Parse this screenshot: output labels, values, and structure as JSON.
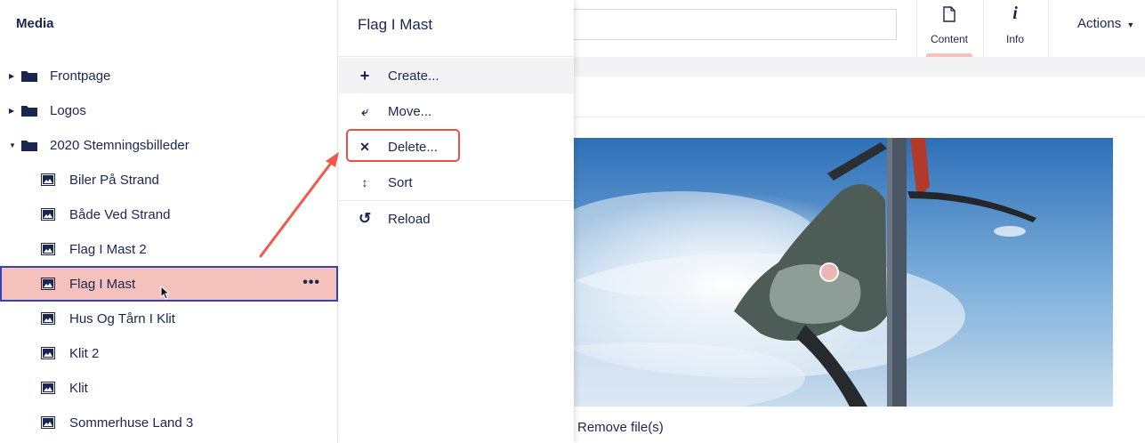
{
  "sidebar": {
    "title": "Media",
    "items": [
      {
        "label": "Frontpage",
        "type": "folder",
        "expanded": false
      },
      {
        "label": "Logos",
        "type": "folder",
        "expanded": false
      },
      {
        "label": "2020 Stemningsbilleder",
        "type": "folder",
        "expanded": true
      },
      {
        "label": "Biler På Strand",
        "type": "image"
      },
      {
        "label": "Både Ved Strand",
        "type": "image"
      },
      {
        "label": "Flag I Mast 2",
        "type": "image"
      },
      {
        "label": "Flag I Mast",
        "type": "image",
        "selected": true,
        "more": "•••"
      },
      {
        "label": "Hus Og Tårn I Klit",
        "type": "image"
      },
      {
        "label": "Klit 2",
        "type": "image"
      },
      {
        "label": "Klit",
        "type": "image"
      },
      {
        "label": "Sommerhuse Land 3",
        "type": "image"
      }
    ]
  },
  "menu": {
    "title": "Flag I Mast",
    "items": [
      {
        "label": "Create...",
        "icon": "plus-icon",
        "glyph": "+"
      },
      {
        "label": "Move...",
        "icon": "move-icon",
        "glyph": "⤶"
      },
      {
        "label": "Delete...",
        "icon": "delete-icon",
        "glyph": "✕"
      },
      {
        "label": "Sort",
        "icon": "sort-icon",
        "glyph": "↕"
      },
      {
        "label": "Reload",
        "icon": "reload-icon",
        "glyph": "↺"
      }
    ]
  },
  "header": {
    "name_value": "",
    "apps": [
      {
        "label": "Content",
        "icon": "document-icon",
        "active": true
      },
      {
        "label": "Info",
        "icon": "info-icon",
        "active": false
      }
    ],
    "actions_label": "Actions"
  },
  "content": {
    "remove_files_label": "Remove file(s)"
  },
  "colors": {
    "selected_bg": "#f5c1bc",
    "selected_border": "#3544b1",
    "annotation": "#e8504a",
    "text": "#1b264f"
  }
}
